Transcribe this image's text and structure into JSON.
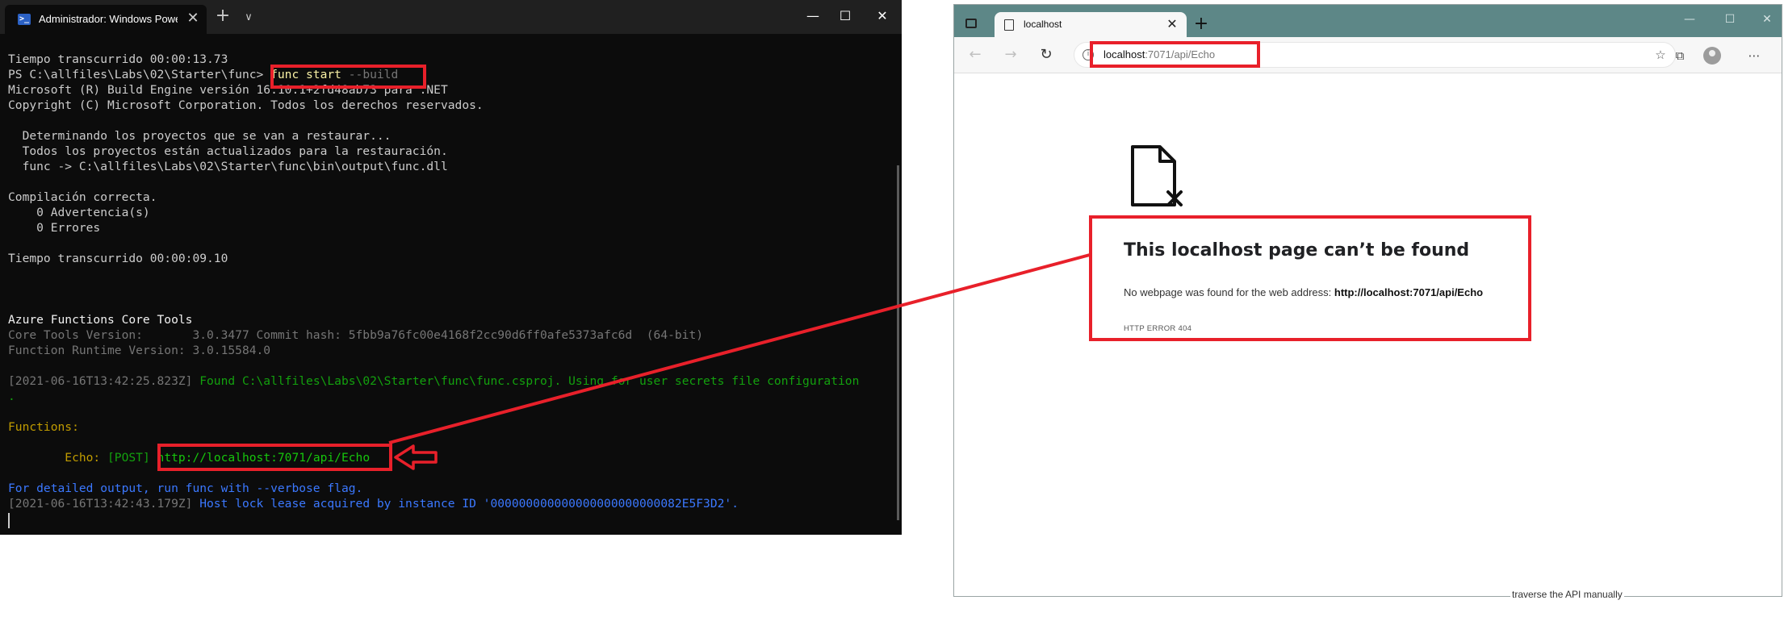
{
  "terminal": {
    "tab_title": "Administrador: Windows PowerShell",
    "ps_icon_glyph": ">_",
    "window_buttons": {
      "minimize": "—",
      "maximize": "☐",
      "close": "✕"
    },
    "new_tab": "+",
    "dropdown": "∨",
    "lines": {
      "l1": "Tiempo transcurrido 00:00:13.73",
      "l2_prompt": "PS C:\\allfiles\\Labs\\02\\Starter\\func> ",
      "l2_cmd": "func start",
      "l2_arg": " --build",
      "l3": "Microsoft (R) Build Engine versión 16.10.1+2fd48ab73 para .NET",
      "l4": "Copyright (C) Microsoft Corporation. Todos los derechos reservados.",
      "l5": "  Determinando los proyectos que se van a restaurar...",
      "l6": "  Todos los proyectos están actualizados para la restauración.",
      "l7": "  func -> C:\\allfiles\\Labs\\02\\Starter\\func\\bin\\output\\func.dll",
      "l8": "Compilación correcta.",
      "l9": "    0 Advertencia(s)",
      "l10": "    0 Errores",
      "l11": "Tiempo transcurrido 00:00:09.10",
      "l12": "Azure Functions Core Tools",
      "l13": "Core Tools Version:       3.0.3477 Commit hash: 5fbb9a76fc00e4168f2cc90d6ff0afe5373afc6d  (64-bit)",
      "l14": "Function Runtime Version: 3.0.15584.0",
      "l15_ts": "[2021-06-16T13:42:25.823Z] ",
      "l15_msg": "Found C:\\allfiles\\Labs\\02\\Starter\\func\\func.csproj. Using for user secrets file configuration",
      "l16": ".",
      "l17": "Functions:",
      "l18_name": "        Echo: ",
      "l18_method": "[POST] ",
      "l18_url": "http://localhost:7071/api/Echo",
      "l19": "For detailed output, run func with --verbose flag.",
      "l20_ts": "[2021-06-16T13:42:43.179Z] ",
      "l20_msg": "Host lock lease acquired by instance ID '000000000000000000000000082E5F3D2'."
    }
  },
  "browser": {
    "tab_title": "localhost",
    "tab_close": "✕",
    "new_tab": "+",
    "window_buttons": {
      "minimize": "—",
      "maximize": "☐",
      "close": "✕"
    },
    "nav": {
      "back": "←",
      "forward": "→",
      "reload": "↻"
    },
    "info_icon": "i",
    "address": {
      "host": "localhost",
      "rest": ":7071/api/Echo"
    },
    "toolbar_icons": {
      "favorite": "☆",
      "collections": "⧉",
      "menu": "⋯"
    },
    "error": {
      "title": "This localhost page can’t be found",
      "desc_prefix": "No webpage was found for the web address: ",
      "desc_url": "http://localhost:7071/api/Echo",
      "code": "HTTP ERROR 404"
    },
    "behind_text": "traverse the API manually"
  },
  "annotation": {
    "color": "#e8202a"
  },
  "colors": {
    "terminal_bg": "#0c0c0c",
    "terminal_text": "#cccccc",
    "green": "#16c60c",
    "orange": "#c19c00",
    "blue": "#3b78ff",
    "browser_titlebar": "#5d8787"
  }
}
